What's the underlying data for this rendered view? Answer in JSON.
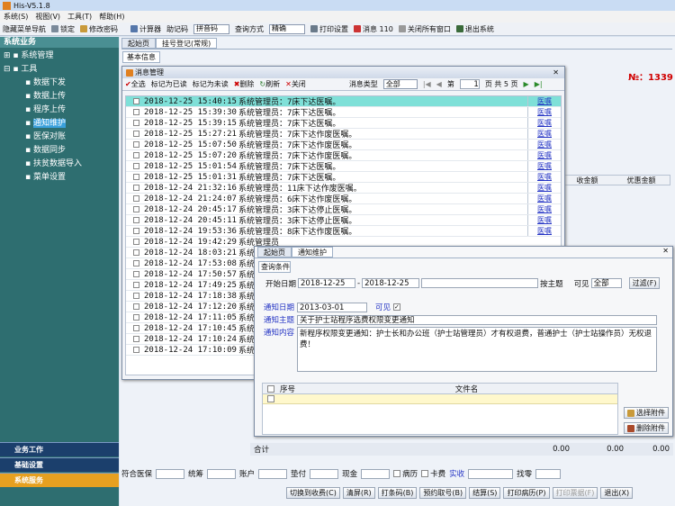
{
  "title": "His-V5.1.8",
  "menu": [
    "系统(S)",
    "视图(V)",
    "工具(T)",
    "帮助(H)"
  ],
  "toolbar": {
    "hide_nav": "隐藏菜单导航",
    "lock": "锁定",
    "change_pwd": "修改密码",
    "calc": "计算器",
    "input_code": "助记码",
    "input_method": "拼音码",
    "query_label": "查询方式",
    "query_value": "精确",
    "print_settings": "打印设置",
    "messages": "消息",
    "msg_count": "110",
    "close_all": "关闭所有窗口",
    "exit": "退出系统"
  },
  "sidebar": {
    "title": "系统业务",
    "items": [
      "系统管理",
      "工具",
      "数据下发",
      "数据上传",
      "程序上传",
      "通知维护",
      "医保对账",
      "数据同步",
      "扶贫数据导入",
      "菜单设置"
    ],
    "bottom": [
      "业务工作",
      "基础设置",
      "系统服务"
    ]
  },
  "main": {
    "tabs": [
      "起始页",
      "挂号登记(常规)"
    ],
    "basic_info": "基本信息",
    "number": "№：1339",
    "col_discount": "收金额",
    "col_pref": "优惠金额",
    "total_label": "合计",
    "total1": "0.00",
    "total2": "0.00",
    "total3": "0.00",
    "bottom_fields": [
      "符合医保",
      "统筹",
      "账户",
      "垫付",
      "现金",
      "病历",
      "卡费",
      "实收",
      "找零"
    ],
    "buttons": [
      "切换到收费(C)",
      "清屏(R)",
      "打条码(B)",
      "预约取号(B)",
      "结算(S)",
      "打印病历(P)",
      "打印票据(F)",
      "退出(X)"
    ]
  },
  "msgdlg": {
    "title": "消息管理",
    "tools": [
      "全选",
      "标记为已读",
      "标记为未读",
      "删除",
      "刷新",
      "关闭"
    ],
    "type_label": "消息类型",
    "type_value": "全部",
    "page_prefix": "第",
    "page": "1",
    "page_suffix": "页 共 5 页",
    "link": "医嘱",
    "rows": [
      [
        "2018-12-25 15:40:15",
        "系统管理员：7床下达医嘱。"
      ],
      [
        "2018-12-25 15:39:30",
        "系统管理员：7床下达医嘱。"
      ],
      [
        "2018-12-25 15:39:15",
        "系统管理员：7床下达医嘱。"
      ],
      [
        "2018-12-25 15:27:21",
        "系统管理员：7床下达作废医嘱。"
      ],
      [
        "2018-12-25 15:07:50",
        "系统管理员：7床下达作废医嘱。"
      ],
      [
        "2018-12-25 15:07:20",
        "系统管理员：7床下达作废医嘱。"
      ],
      [
        "2018-12-25 15:01:54",
        "系统管理员：7床下达医嘱。"
      ],
      [
        "2018-12-25 15:01:31",
        "系统管理员：7床下达医嘱。"
      ],
      [
        "2018-12-24 21:32:16",
        "系统管理员：11床下达作废医嘱。"
      ],
      [
        "2018-12-24 21:24:07",
        "系统管理员：6床下达作废医嘱。"
      ],
      [
        "2018-12-24 20:45:17",
        "系统管理员：3床下达停止医嘱。"
      ],
      [
        "2018-12-24 20:45:11",
        "系统管理员：3床下达停止医嘱。"
      ],
      [
        "2018-12-24 19:53:36",
        "系统管理员：8床下达作废医嘱。"
      ],
      [
        "2018-12-24 19:42:29",
        "系统管理员"
      ],
      [
        "2018-12-24 18:03:21",
        "系统管理员"
      ],
      [
        "2018-12-24 17:53:08",
        "系统管理员"
      ],
      [
        "2018-12-24 17:50:57",
        "系统管理员"
      ],
      [
        "2018-12-24 17:49:25",
        "系统管理员"
      ],
      [
        "2018-12-24 17:18:38",
        "系统管理员"
      ],
      [
        "2018-12-24 17:12:20",
        "系统管理员"
      ],
      [
        "2018-12-24 17:11:05",
        "系统管理员"
      ],
      [
        "2018-12-24 17:10:45",
        "系统管理员"
      ],
      [
        "2018-12-24 17:10:24",
        "系统管理员"
      ],
      [
        "2018-12-24 17:10:09",
        "系统管理员"
      ]
    ]
  },
  "notice": {
    "tabs": [
      "起始页",
      "通知维护"
    ],
    "query_tab": "查询条件",
    "start_label": "开始日期",
    "start": "2018-12-25",
    "end": "2018-12-25",
    "subject_label": "按主题",
    "visible_label": "可见",
    "visible_value": "全部",
    "filter": "过滤(F)",
    "date_label": "通知日期",
    "date": "2013-03-01",
    "vis": "可见",
    "subj_label": "通知主题",
    "subject": "关于护士站程序选费权限变更通知",
    "content_label": "通知内容",
    "content": "新程序权限变更通知：护士长和办公班（护士站管理员）才有权退费，普通护士（护士站操作员）无权退费！",
    "col_no": "序号",
    "col_file": "文件名",
    "choose": "选择附件",
    "del": "删除附件"
  }
}
